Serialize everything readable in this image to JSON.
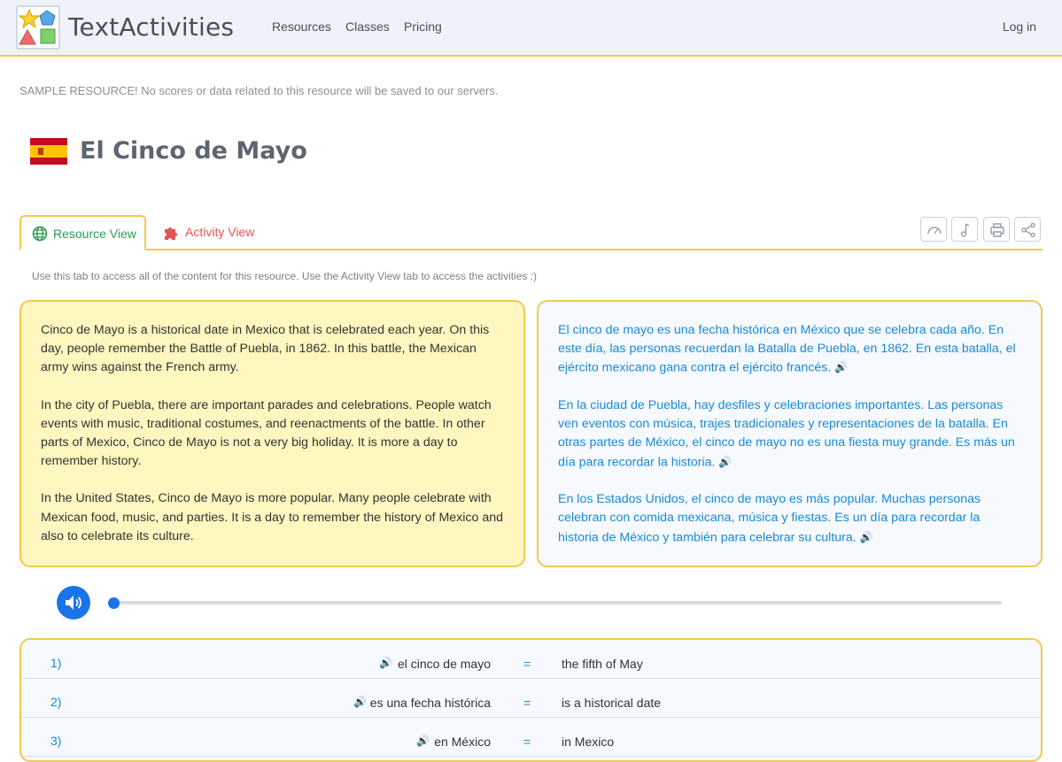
{
  "header": {
    "brand": "TextActivities",
    "nav": [
      "Resources",
      "Classes",
      "Pricing"
    ],
    "login": "Log in"
  },
  "notice": "SAMPLE RESOURCE! No scores or data related to this resource will be saved to our servers.",
  "page_title": "El Cinco de Mayo",
  "tabs": {
    "resource": "Resource View",
    "activity": "Activity View"
  },
  "hint": "Use this tab to access all of the content for this resource. Use the Activity View tab to access the activities :)",
  "english": [
    "Cinco de Mayo is a historical date in Mexico that is celebrated each year. On this day, people remember the Battle of Puebla, in 1862. In this battle, the Mexican army wins against the French army.",
    "In the city of Puebla, there are important parades and celebrations. People watch events with music, traditional costumes, and reenactments of the battle. In other parts of Mexico, Cinco de Mayo is not a very big holiday. It is more a day to remember history.",
    "In the United States, Cinco de Mayo is more popular. Many people celebrate with Mexican food, music, and parties. It is a day to remember the history of Mexico and also to celebrate its culture."
  ],
  "spanish": [
    "El cinco de mayo es una fecha histórica en México que se celebra cada año. En este día, las personas recuerdan la Batalla de Puebla, en 1862. En esta batalla, el ejército mexicano gana contra el ejército francés.",
    "En la ciudad de Puebla, hay desfiles y celebraciones importantes. Las personas ven eventos con música, trajes tradicionales y representaciones de la batalla. En otras partes de México, el cinco de mayo no es una fiesta muy grande. Es más un día para recordar la historia.",
    "En los Estados Unidos, el cinco de mayo es más popular. Muchas personas celebran con comida mexicana, música y fiestas. Es un día para recordar la historia de México y también para celebrar su cultura."
  ],
  "audio": {
    "progress": 0
  },
  "vocab": [
    {
      "num": "1)",
      "es": "el cinco de mayo",
      "eq": "=",
      "en": "the fifth of May"
    },
    {
      "num": "2)",
      "es": "es una fecha histórica",
      "eq": "=",
      "en": "is a historical date"
    },
    {
      "num": "3)",
      "es": "en México",
      "eq": "=",
      "en": "in Mexico"
    }
  ],
  "colors": {
    "accent": "#f2c94c",
    "spanish_text": "#1a8ad7",
    "green_tab": "#2e9b52",
    "red_tab": "#e55353",
    "player": "#1a73e8"
  }
}
